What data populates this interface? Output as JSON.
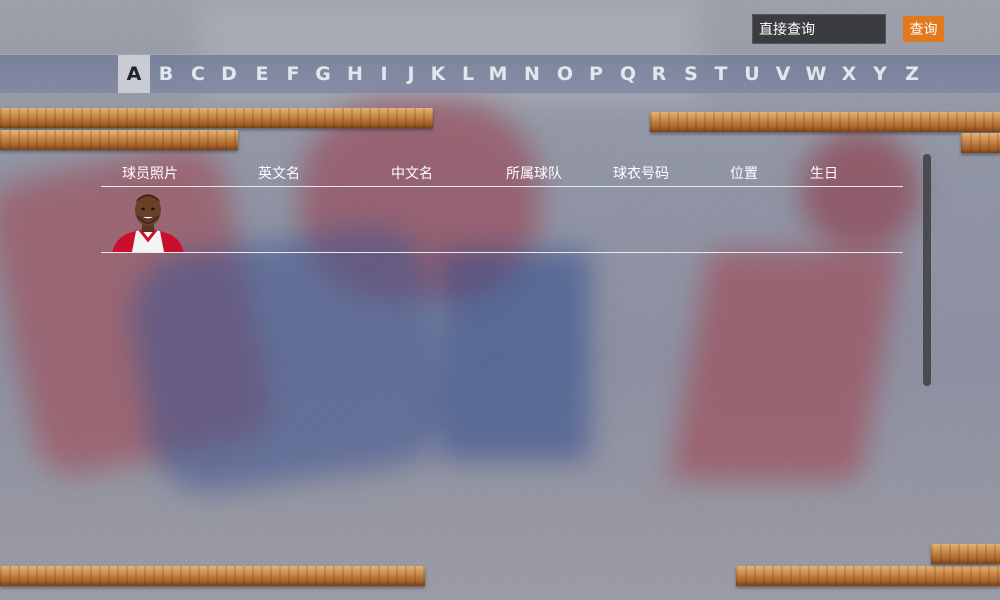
{
  "search": {
    "value": "直接查询",
    "button_label": "查询"
  },
  "alphabet": {
    "letters": [
      "A",
      "B",
      "C",
      "D",
      "E",
      "F",
      "G",
      "H",
      "I",
      "J",
      "K",
      "L",
      "M",
      "N",
      "O",
      "P",
      "Q",
      "R",
      "S",
      "T",
      "U",
      "V",
      "W",
      "X",
      "Y",
      "Z"
    ],
    "selected": "A"
  },
  "table": {
    "columns": [
      "球员照片",
      "英文名",
      "中文名",
      "所属球队",
      "球衣号码",
      "位置",
      "生日"
    ],
    "rows": [
      {
        "photo": "player-photo",
        "english_name": "",
        "chinese_name": "",
        "team": "",
        "number": "",
        "position": "",
        "birthday": ""
      }
    ]
  },
  "colors": {
    "accent": "#e07a1c",
    "alphabet_bar": "#6e7896",
    "active_letter_bg": "#c9ccd4",
    "jersey_red": "#c8102e"
  }
}
